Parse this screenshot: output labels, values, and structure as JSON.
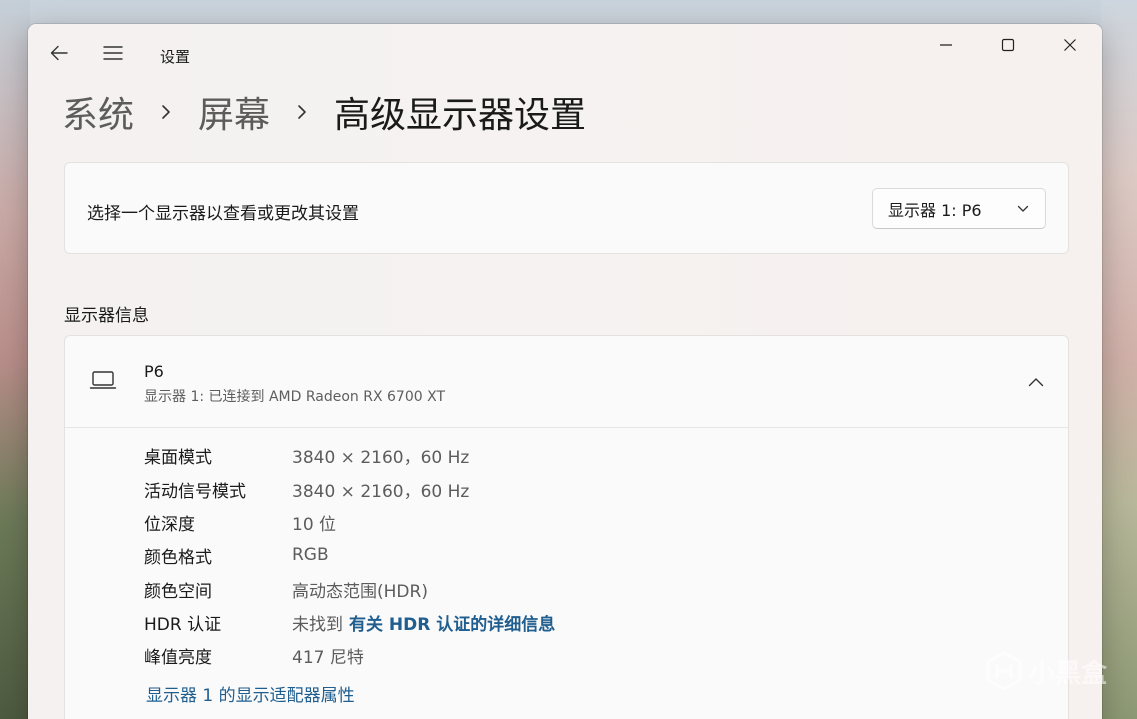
{
  "window": {
    "title": "设置"
  },
  "breadcrumb": {
    "items": [
      "系统",
      "屏幕"
    ],
    "current": "高级显示器设置"
  },
  "select_display": {
    "label": "选择一个显示器以查看或更改其设置",
    "selected": "显示器 1: P6"
  },
  "section": {
    "title": "显示器信息"
  },
  "monitor": {
    "name": "P6",
    "subtitle": "显示器 1: 已连接到 AMD Radeon RX 6700 XT",
    "rows": [
      {
        "label": "桌面模式",
        "value": "3840 × 2160，60 Hz"
      },
      {
        "label": "活动信号模式",
        "value": "3840 × 2160，60 Hz"
      },
      {
        "label": "位深度",
        "value": "10 位"
      },
      {
        "label": "颜色格式",
        "value": "RGB"
      },
      {
        "label": "颜色空间",
        "value": "高动态范围(HDR)"
      },
      {
        "label": "HDR 认证",
        "value": "未找到",
        "link": "有关 HDR 认证的详细信息"
      },
      {
        "label": "峰值亮度",
        "value": "417 尼特"
      }
    ],
    "adapter_link": "显示器 1 的显示适配器属性"
  },
  "watermark": {
    "text": "小黑盒"
  },
  "colors": {
    "link": "#1f5e8f",
    "window_bg": "#f3f1f1",
    "card_bg": "#fbfafa"
  },
  "icons": [
    "back-arrow-icon",
    "hamburger-menu-icon",
    "minimize-icon",
    "maximize-icon",
    "close-icon",
    "chevron-down-icon",
    "laptop-icon",
    "chevron-up-icon",
    "chevron-right-icon",
    "xiaoheihe-logo-icon"
  ]
}
